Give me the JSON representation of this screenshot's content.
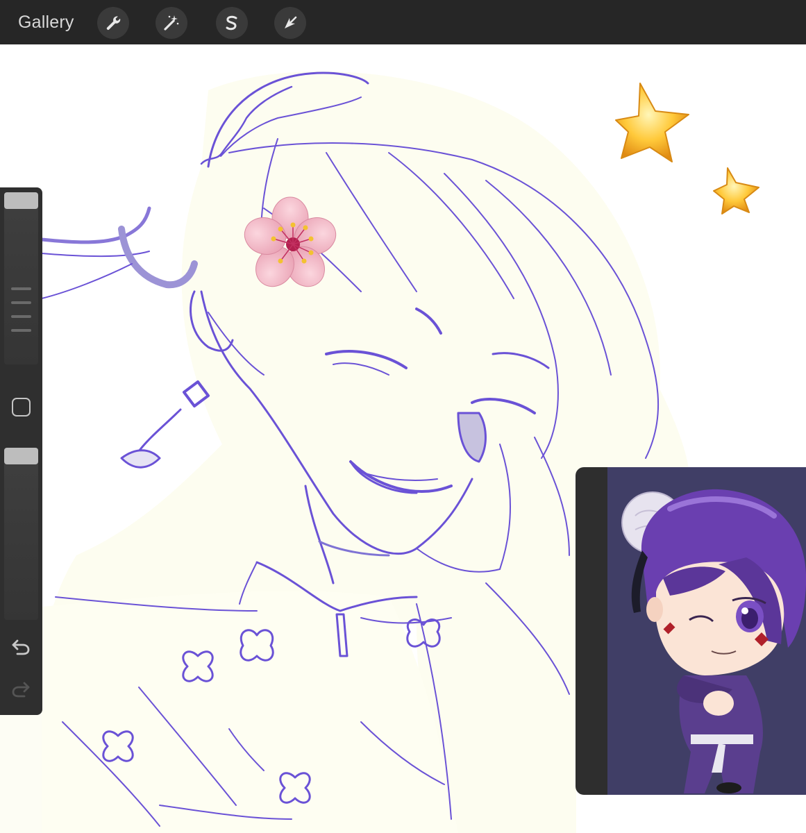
{
  "toolbar": {
    "gallery_label": "Gallery",
    "tools": [
      {
        "name": "actions",
        "icon": "wrench-icon"
      },
      {
        "name": "adjustments",
        "icon": "magic-wand-icon"
      },
      {
        "name": "selection",
        "icon": "selection-s-icon"
      },
      {
        "name": "transform",
        "icon": "arrow-cursor-icon"
      }
    ]
  },
  "sidebar": {
    "brush_size": 0.0,
    "opacity": 0.0,
    "controls": [
      "brush-size-slider",
      "modify-button",
      "opacity-slider",
      "undo-icon",
      "redo-icon"
    ]
  },
  "canvas": {
    "stickers": [
      "cherry-blossom-emoji",
      "star-emoji",
      "star-emoji"
    ],
    "line_color": "#6a52d6",
    "paper_color": "#fdfdf0"
  },
  "reference": {
    "background_color": "#403e66"
  }
}
